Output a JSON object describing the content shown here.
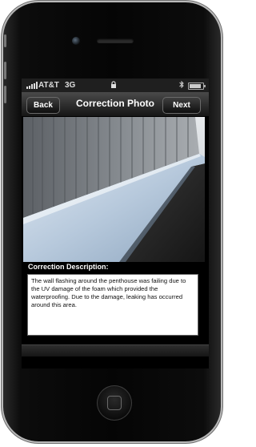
{
  "status_bar": {
    "carrier": "AT&T",
    "network": "3G"
  },
  "nav": {
    "title": "Correction Photo",
    "back_label": "Back",
    "next_label": "Next"
  },
  "correction": {
    "label": "Correction Description:",
    "text": "The wall flashing around the penthouse was failing due to the UV damage of the foam which provided the waterproofing. Due to the damage, leaking has occurred around this area."
  },
  "icons": {
    "signal": "signal-bars-icon",
    "lock": "lock-icon",
    "bluetooth": "bluetooth-icon",
    "battery": "battery-icon"
  },
  "colors": {
    "navbar": "#2a2a2a",
    "screen_background": "#000000",
    "text_box": "#ffffff"
  }
}
